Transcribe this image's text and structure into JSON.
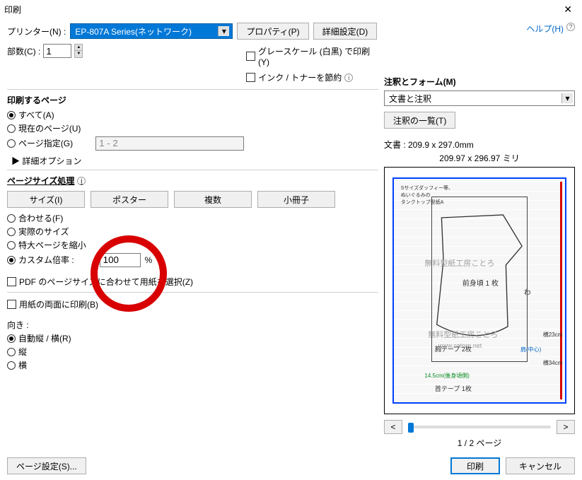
{
  "title": "印刷",
  "close_label": "✕",
  "printer": {
    "label": "プリンター(N) :",
    "value": "EP-807A Series(ネットワーク)",
    "properties_btn": "プロパティ(P)",
    "advanced_btn": "詳細設定(D)"
  },
  "help_label": "ヘルプ(H)",
  "copies": {
    "label": "部数(C) :",
    "value": "1"
  },
  "grayscale_label": "グレースケール (白黒) で印刷(Y)",
  "ink_save_label": "インク / トナーを節約",
  "pages_section": {
    "title": "印刷するページ",
    "all": "すべて(A)",
    "current": "現在のページ(U)",
    "range": "ページ指定(G)",
    "range_value": "1 - 2",
    "advanced": "▶ 詳細オプション"
  },
  "size_section": {
    "title": "ページサイズ処理",
    "tabs": {
      "size": "サイズ(I)",
      "poster": "ポスター",
      "multi": "複数",
      "booklet": "小冊子"
    },
    "fit": "合わせる(F)",
    "actual": "実際のサイズ",
    "shrink": "特大ページを縮小",
    "custom": "カスタム倍率 :",
    "custom_value": "100",
    "custom_unit": "%",
    "pdf_paper": "PDF のページサイズに合わせて用紙を選択(Z)"
  },
  "duplex_label": "用紙の両面に印刷(B)",
  "orient_section": {
    "title": "向き :",
    "auto": "自動縦 / 横(R)",
    "portrait": "縦",
    "landscape": "横"
  },
  "annot_section": {
    "title": "注釈とフォーム(M)",
    "combo_value": "文書と注釈",
    "list_btn": "注釈の一覧(T)"
  },
  "doc_label": "文書 : 209.9 x 297.0mm",
  "preview_size": "209.97 x 296.97 ミリ",
  "preview_watermark1": "無料型紙工房ことろ",
  "preview_watermark2": "www.cotoro.net",
  "preview_tags": {
    "front": "前身頃  1 枚",
    "wa": "わ",
    "chest": "胸テープ  2枚",
    "neck": "首テープ  1枚",
    "w23": "横23cm",
    "w34": "横34cm",
    "len": "14.5cm(後身頃側)",
    "shoulder": "肩(中心)",
    "heading": "Sサイズダッフィー等、\nぬいぐるみの\nタンクトップ型紙A"
  },
  "pager_label": "1 / 2 ページ",
  "footer": {
    "page_setup": "ページ設定(S)...",
    "print": "印刷",
    "cancel": "キャンセル"
  }
}
